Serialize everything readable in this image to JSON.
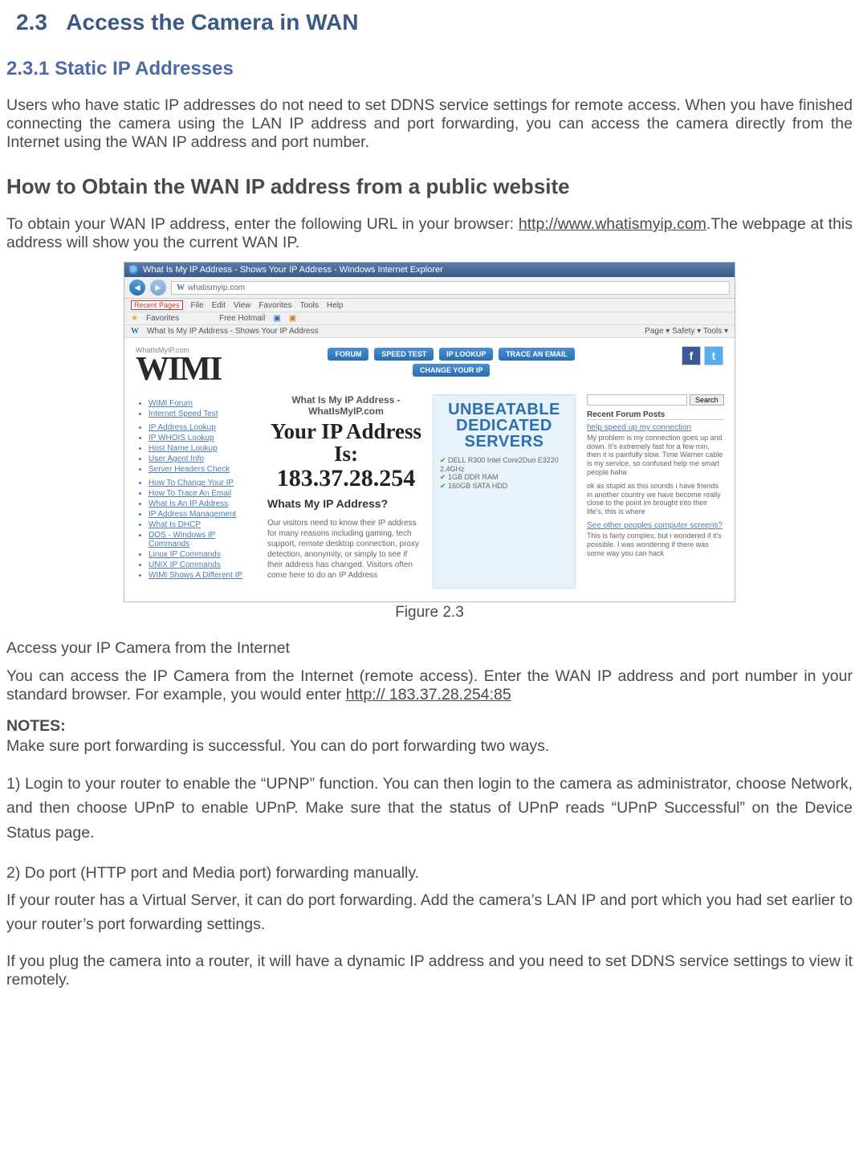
{
  "section": {
    "number": "2.3",
    "title": "Access the Camera in WAN"
  },
  "subsection": {
    "number": "2.3.1",
    "title": "Static IP Addresses"
  },
  "intro_paragraph": "Users who have static IP addresses do not need to set DDNS service settings for remote access. When you have finished connecting the camera using the LAN IP address and port forwarding, you can access the camera directly from the Internet using the WAN IP address and port number.",
  "howto_heading": "How to Obtain the WAN IP address from a public website",
  "howto_text_pre": "To obtain your WAN IP address, enter the following URL in your browser: ",
  "howto_link": "http://www.whatismyip.com",
  "howto_text_post": ".The webpage at this address will show you the current WAN IP.",
  "figure_caption": "Figure 2.3",
  "access_topic": "Access your IP Camera from the Internet",
  "access_text_pre": "You can access the IP Camera from the Internet (remote access). Enter the WAN IP address and port number in your standard browser. For example, you would enter ",
  "access_example_url": "http:// 183.37.28.254:85",
  "notes_label": "NOTES:",
  "notes_intro": "Make sure port forwarding is successful. You can do port forwarding two ways.",
  "step1": "1) Login to your router to enable the “UPNP” function. You can then login to the camera as administrator, choose Network, and then choose UPnP to enable UPnP. Make sure that the status of UPnP reads “UPnP Successful” on the Device Status page.",
  "step2a": "2) Do port (HTTP port and Media port) forwarding manually.",
  "step2b": "If your router has a Virtual Server, it can do port forwarding. Add the camera’s LAN IP and port which you had set earlier to your router’s port forwarding settings.",
  "closing": "If you plug the camera into a router, it will have a dynamic IP address and you need to set DDNS service settings to view it remotely.",
  "screenshot": {
    "titlebar": "What Is My IP Address - Shows Your IP Address - Windows Internet Explorer",
    "url": "whatismyip.com",
    "recent_pages": "Recent Pages",
    "menu": [
      "File",
      "Edit",
      "View",
      "Favorites",
      "Tools",
      "Help"
    ],
    "favorites_label": "Favorites",
    "free_hotmail": "Free Hotmail",
    "tab_title": "What Is My IP Address - Shows Your IP Address",
    "toolbar_right": "Page ▾   Safety ▾   Tools ▾",
    "wimi_brand_small": "WhatIsMyIP.com",
    "wimi_brand": "WIMI",
    "nav_buttons": [
      "FORUM",
      "SPEED TEST",
      "IP LOOKUP",
      "TRACE AN EMAIL"
    ],
    "change_ip_button": "CHANGE YOUR IP",
    "left_links_group1": [
      "WIMI Forum",
      "Internet Speed Test"
    ],
    "left_links_group2": [
      "IP Address Lookup",
      "IP WHOIS Lookup",
      "Host Name Lookup",
      "User Agent Info",
      "Server Headers Check"
    ],
    "left_links_group3": [
      "How To Change Your IP",
      "How To Trace An Email",
      "What Is An IP Address",
      "IP Address Management",
      "What Is DHCP",
      "DOS - Windows IP Commands",
      "Linux IP Commands",
      "UNIX IP Commands",
      "WIMI Shows A Different IP"
    ],
    "page_headline": "What Is My IP Address - WhatIsMyIP.com",
    "big_title": "Your IP Address Is:",
    "big_value": "183.37.28.254",
    "whats_my_ip": "Whats My IP Address?",
    "ip_desc": "Our visitors need to know their IP address for many reasons including gaming, tech support, remote desktop connection, proxy detection, anonymity, or simply to see if their address has changed. Visitors often come here to do an IP Address",
    "ad_line1": "UNBEATABLE",
    "ad_line2": "DEDICATED",
    "ad_line3": "SERVERS",
    "ad_specs": [
      "DELL R300 Intel Core2Duo E3220 2.4GHz",
      "1GB DDR RAM",
      "160GB SATA HDD"
    ],
    "search_button": "Search",
    "forum_title": "Recent Forum Posts",
    "forum_post1_title": "help speed up my connection",
    "forum_post1_body": "My problem is my connection goes up and down. It's extremely fast for a few min, then it is painfully slow. Time Warner cable is my service, so confused help me smart people haha",
    "forum_post2_body": "ok as stupid as this sounds i have friends in another country we have become really close to the point im brought into their life's, this is where",
    "forum_post3_title": "See other peoples computer screens?",
    "forum_post3_body": "This is fairly complex, but i wondered if it's possible. I was wondering if there was some way you can hack"
  }
}
